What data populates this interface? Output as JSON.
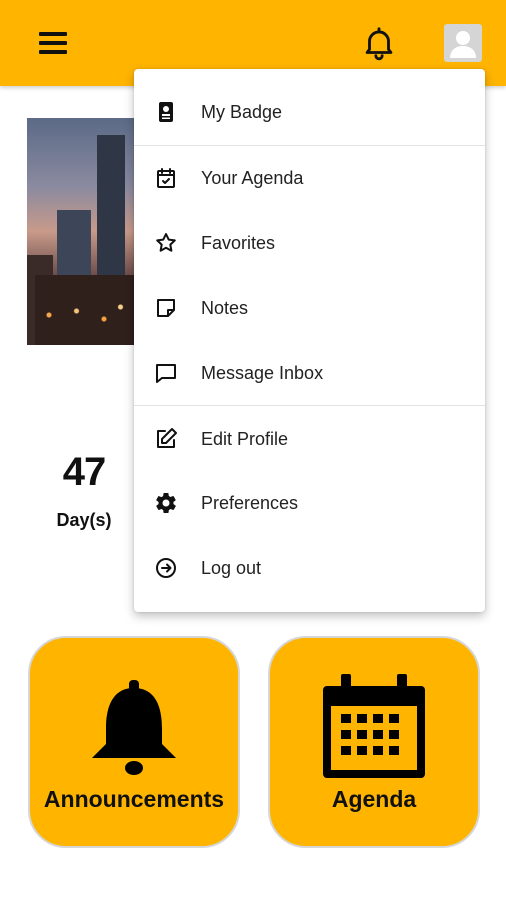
{
  "header": {
    "menu_icon": "hamburger-menu-icon",
    "notifications_icon": "bell-icon",
    "avatar_icon": "user-avatar-icon"
  },
  "countdown": {
    "value": "47",
    "unit": "Day(s)"
  },
  "tiles": [
    {
      "label": "Announcements",
      "icon": "bell-icon"
    },
    {
      "label": "Agenda",
      "icon": "calendar-icon"
    }
  ],
  "user_menu": {
    "items": [
      {
        "label": "My Badge",
        "icon": "badge-icon"
      },
      {
        "label": "Your Agenda",
        "icon": "calendar-check-icon"
      },
      {
        "label": "Favorites",
        "icon": "star-icon"
      },
      {
        "label": "Notes",
        "icon": "note-icon"
      },
      {
        "label": "Message Inbox",
        "icon": "chat-icon"
      },
      {
        "label": "Edit Profile",
        "icon": "edit-icon"
      },
      {
        "label": "Preferences",
        "icon": "gear-icon"
      },
      {
        "label": "Log out",
        "icon": "logout-icon"
      }
    ]
  },
  "colors": {
    "accent": "#FFB400",
    "text": "#111111"
  }
}
